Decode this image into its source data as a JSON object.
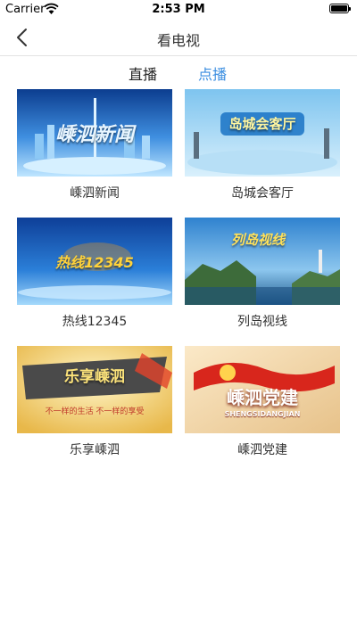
{
  "status": {
    "carrier": "Carrier",
    "time": "2:53 PM"
  },
  "nav": {
    "title": "看电视"
  },
  "tabs": [
    {
      "label": "直播",
      "active": false
    },
    {
      "label": "点播",
      "active": true
    }
  ],
  "programs": [
    {
      "name": "嵊泗新闻",
      "overlay": "嵊泗新闻"
    },
    {
      "name": "岛城会客厅",
      "overlay": "岛城会客厅"
    },
    {
      "name": "热线12345",
      "overlay": "热线12345"
    },
    {
      "name": "列岛视线",
      "overlay": "列岛视线"
    },
    {
      "name": "乐享嵊泗",
      "overlay": "乐享嵊泗",
      "sub": "不一样的生活 不一样的享受"
    },
    {
      "name": "嵊泗党建",
      "overlay": "嵊泗党建",
      "sub": "SHENGSIDANGJIAN"
    }
  ],
  "colors": {
    "accent": "#3a8de0"
  }
}
